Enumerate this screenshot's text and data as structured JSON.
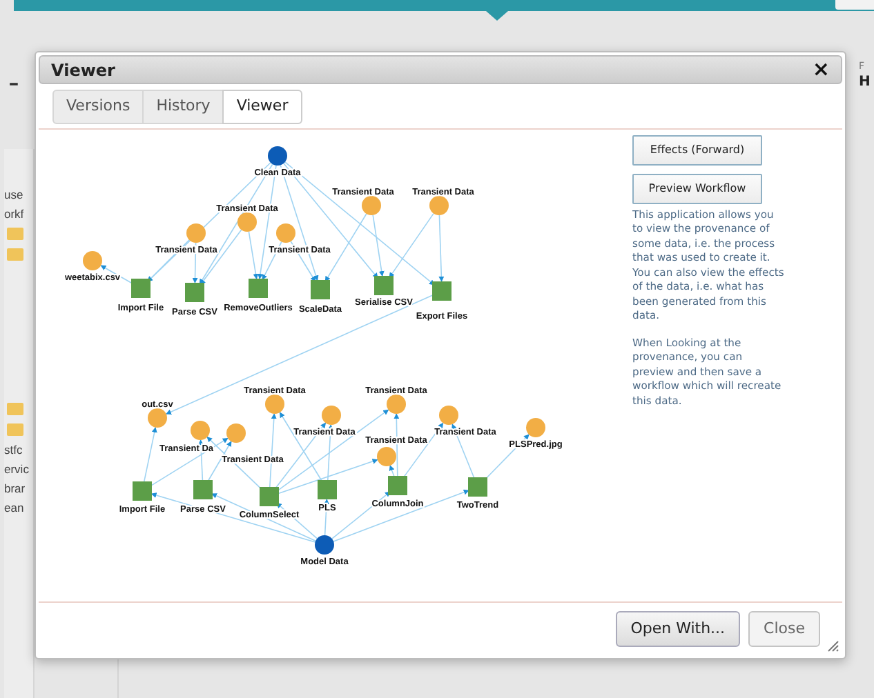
{
  "background": {
    "heading_fragment": "-",
    "right_fragments": [
      "F",
      "H"
    ],
    "sidebar_groups": [
      [
        {
          "kind": "text",
          "label": "use"
        },
        {
          "kind": "text",
          "label": "orkf"
        },
        {
          "kind": "folder"
        },
        {
          "kind": "folder"
        }
      ],
      [
        {
          "kind": "folder"
        },
        {
          "kind": "folder"
        },
        {
          "kind": "text",
          "label": "stfc"
        },
        {
          "kind": "text",
          "label": "ervic"
        },
        {
          "kind": "text",
          "label": "brar"
        },
        {
          "kind": "text",
          "label": "ean"
        }
      ]
    ]
  },
  "dialog": {
    "title": "Viewer",
    "close": "×",
    "tabs": [
      {
        "label": "Versions",
        "selected": false
      },
      {
        "label": "History",
        "selected": false
      },
      {
        "label": "Viewer",
        "selected": true
      }
    ],
    "graph": {
      "nodes": [
        {
          "kind": "result",
          "label": "Clean Data"
        },
        {
          "kind": "data",
          "label": "Transient Data"
        },
        {
          "kind": "data",
          "label": "Transient Data"
        },
        {
          "kind": "data",
          "label": "Transient Data"
        },
        {
          "kind": "data",
          "label": "Transient Data"
        },
        {
          "kind": "data",
          "label": "Transient Data"
        },
        {
          "kind": "data",
          "label": "weetabix.csv"
        },
        {
          "kind": "process",
          "label": "Import File"
        },
        {
          "kind": "process",
          "label": "Parse CSV"
        },
        {
          "kind": "process",
          "label": "RemoveOutliers"
        },
        {
          "kind": "process",
          "label": "ScaleData"
        },
        {
          "kind": "process",
          "label": "Serialise CSV"
        },
        {
          "kind": "process",
          "label": "Export Files"
        },
        {
          "kind": "data",
          "label": "out.csv"
        },
        {
          "kind": "data",
          "label": "Transient Da"
        },
        {
          "kind": "data",
          "label": "Transient Data"
        },
        {
          "kind": "data",
          "label": "Transient Data"
        },
        {
          "kind": "data",
          "label": "Transient Data"
        },
        {
          "kind": "data",
          "label": "Transient Data"
        },
        {
          "kind": "data",
          "label": "Transient Data"
        },
        {
          "kind": "data",
          "label": "PLSPred.jpg"
        },
        {
          "kind": "data",
          "label": "Transient Data"
        },
        {
          "kind": "process",
          "label": "Import File"
        },
        {
          "kind": "process",
          "label": "Parse CSV"
        },
        {
          "kind": "process",
          "label": "ColumnSelect"
        },
        {
          "kind": "process",
          "label": "PLS"
        },
        {
          "kind": "process",
          "label": "ColumnJoin"
        },
        {
          "kind": "process",
          "label": "TwoTrend"
        },
        {
          "kind": "result",
          "label": "Model Data"
        }
      ]
    },
    "side_buttons": [
      "Effects (Forward)",
      "Preview Workflow"
    ],
    "paragraphs": [
      "This application allows you to view the provenance of some data, i.e. the process that was used to create it. You can also view the effects of the data, i.e. what has been generated from this data.",
      "When Looking at the provenance, you can preview and then save a workflow which will recreate this data."
    ],
    "footer_buttons": [
      {
        "label": "Open With...",
        "kind": "primary"
      },
      {
        "label": "Close",
        "kind": "secondary"
      }
    ]
  }
}
